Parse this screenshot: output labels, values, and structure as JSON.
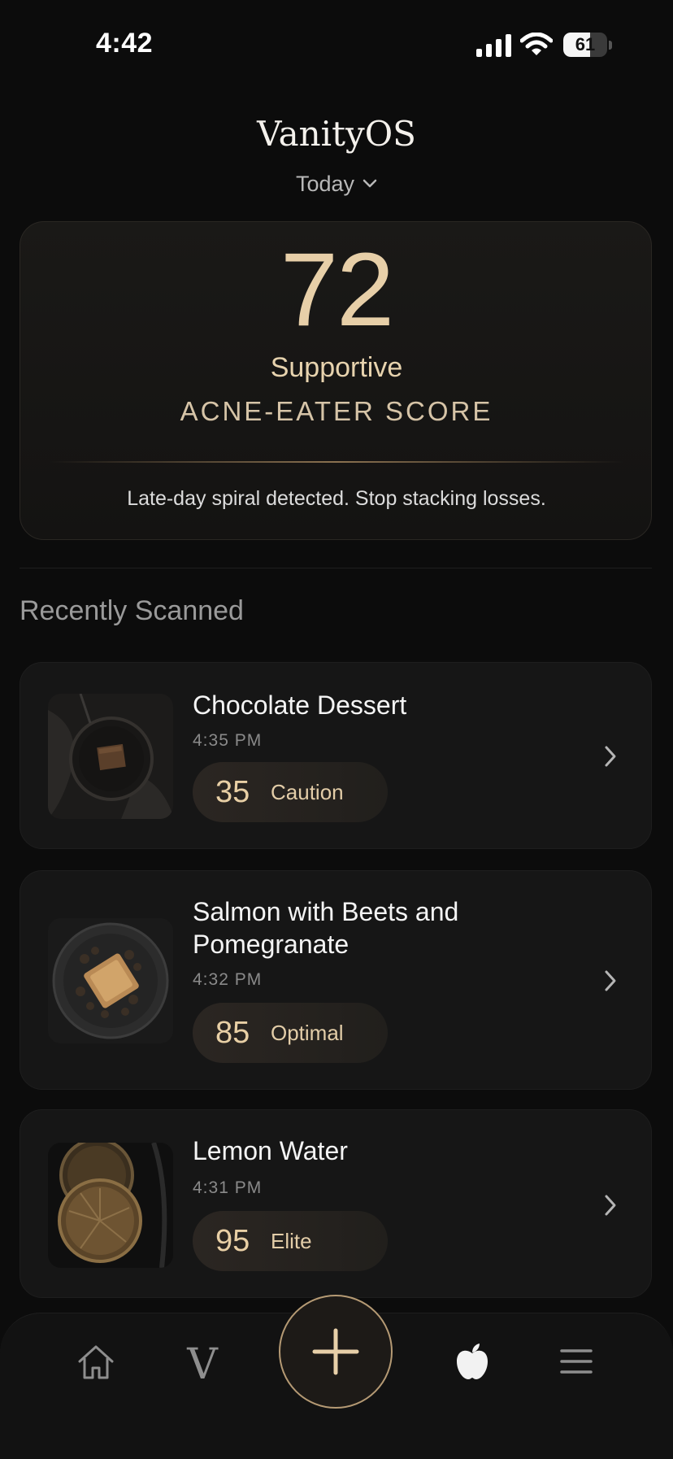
{
  "status_bar": {
    "time": "4:42",
    "battery_level": "61",
    "battery_fraction": 0.61
  },
  "header": {
    "title": "VanityOS",
    "date_selector": "Today"
  },
  "score_card": {
    "score": "72",
    "level": "Supportive",
    "label": "ACNE-EATER SCORE",
    "message": "Late-day spiral detected. Stop stacking losses."
  },
  "recent": {
    "title": "Recently Scanned",
    "items": [
      {
        "name": "Chocolate Dessert",
        "time": "4:35 PM",
        "score": "35",
        "rating": "Caution"
      },
      {
        "name": "Salmon with Beets and Pomegranate",
        "time": "4:32 PM",
        "score": "85",
        "rating": "Optimal"
      },
      {
        "name": "Lemon Water",
        "time": "4:31 PM",
        "score": "95",
        "rating": "Elite"
      }
    ]
  },
  "nav": {
    "home_icon": "home-icon",
    "vanity_label": "V",
    "add_icon": "plus-icon",
    "nutrition_icon": "apple-icon",
    "menu_icon": "menu-icon"
  },
  "colors": {
    "accent_gold": "#e7cfa8",
    "background": "#0c0c0c",
    "card": "#161616"
  }
}
